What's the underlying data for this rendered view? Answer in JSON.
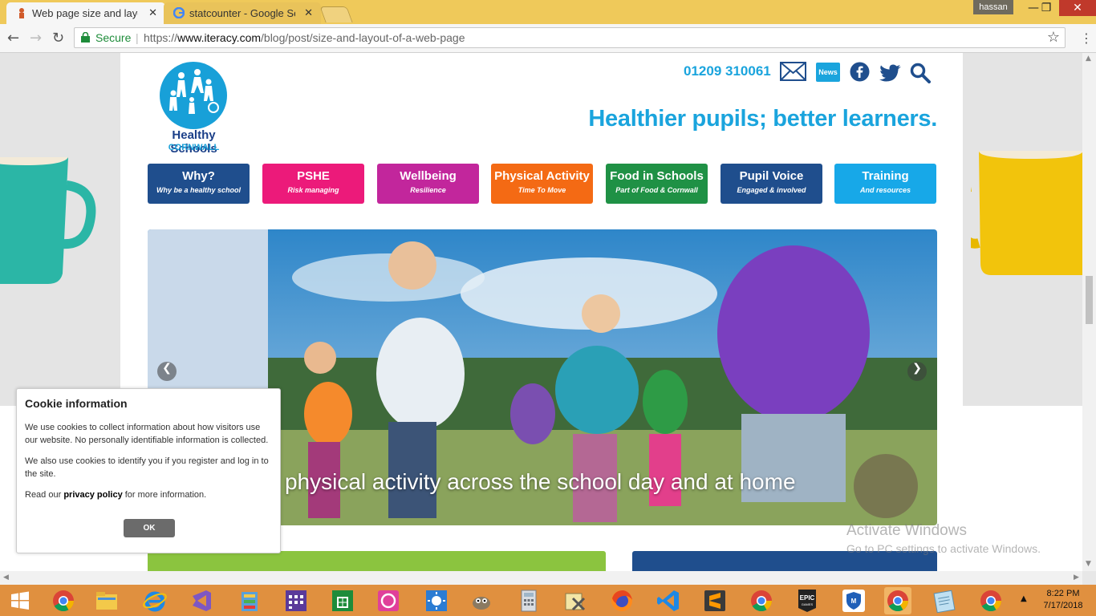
{
  "browser": {
    "tabs": [
      {
        "title": "Web page size and layou",
        "close": "✕"
      },
      {
        "title": "statcounter - Google Sear",
        "close": "✕"
      }
    ],
    "user": "hassan",
    "window_buttons": {
      "minimize": "—",
      "maximize": "❐",
      "close": "✕"
    },
    "nav": {
      "back": "←",
      "forward": "→",
      "reload": "↻"
    },
    "secure_label": "Secure",
    "url_scheme": "https://",
    "url_domain": "www.iteracy.com",
    "url_path": "/blog/post/size-and-layout-of-a-web-page",
    "star": "☆",
    "menu": "⋮"
  },
  "site": {
    "logo_title": "Healthy Schools",
    "logo_sub": "CORNWALL",
    "phone": "01209 310061",
    "news_label": "News",
    "tagline": "Healthier pupils; better learners.",
    "nav": [
      {
        "label": "Why?",
        "sub": "Why be a healthy school",
        "color": "#1f4e8d"
      },
      {
        "label": "PSHE",
        "sub": "Risk managing",
        "color": "#ec1a7a"
      },
      {
        "label": "Wellbeing",
        "sub": "Resilience",
        "color": "#c2269c"
      },
      {
        "label": "Physical Activity",
        "sub": "Time To Move",
        "color": "#f46a14"
      },
      {
        "label": "Food in Schools",
        "sub": "Part of Food & Cornwall",
        "color": "#1f9145"
      },
      {
        "label": "Pupil Voice",
        "sub": "Engaged & involved",
        "color": "#1f4e8d"
      },
      {
        "label": "Training",
        "sub": "And resources",
        "color": "#17a8e8"
      }
    ],
    "hero_caption": "Increasing physical activity across the school day and at home",
    "arrows": {
      "prev": "❮",
      "next": "❯"
    }
  },
  "cookie": {
    "title": "Cookie information",
    "p1": "We use cookies to collect information about how visitors use our website. No personally identifiable information is collected.",
    "p2": "We also use cookies to identify you if you register and log in to the site.",
    "p3_pre": "Read our ",
    "p3_link": "privacy policy",
    "p3_post": " for more information.",
    "ok": "OK"
  },
  "watermark": {
    "line1": "Activate Windows",
    "line2": "Go to PC settings to activate Windows."
  },
  "taskbar": {
    "time": "8:22 PM",
    "date": "7/17/2018"
  }
}
